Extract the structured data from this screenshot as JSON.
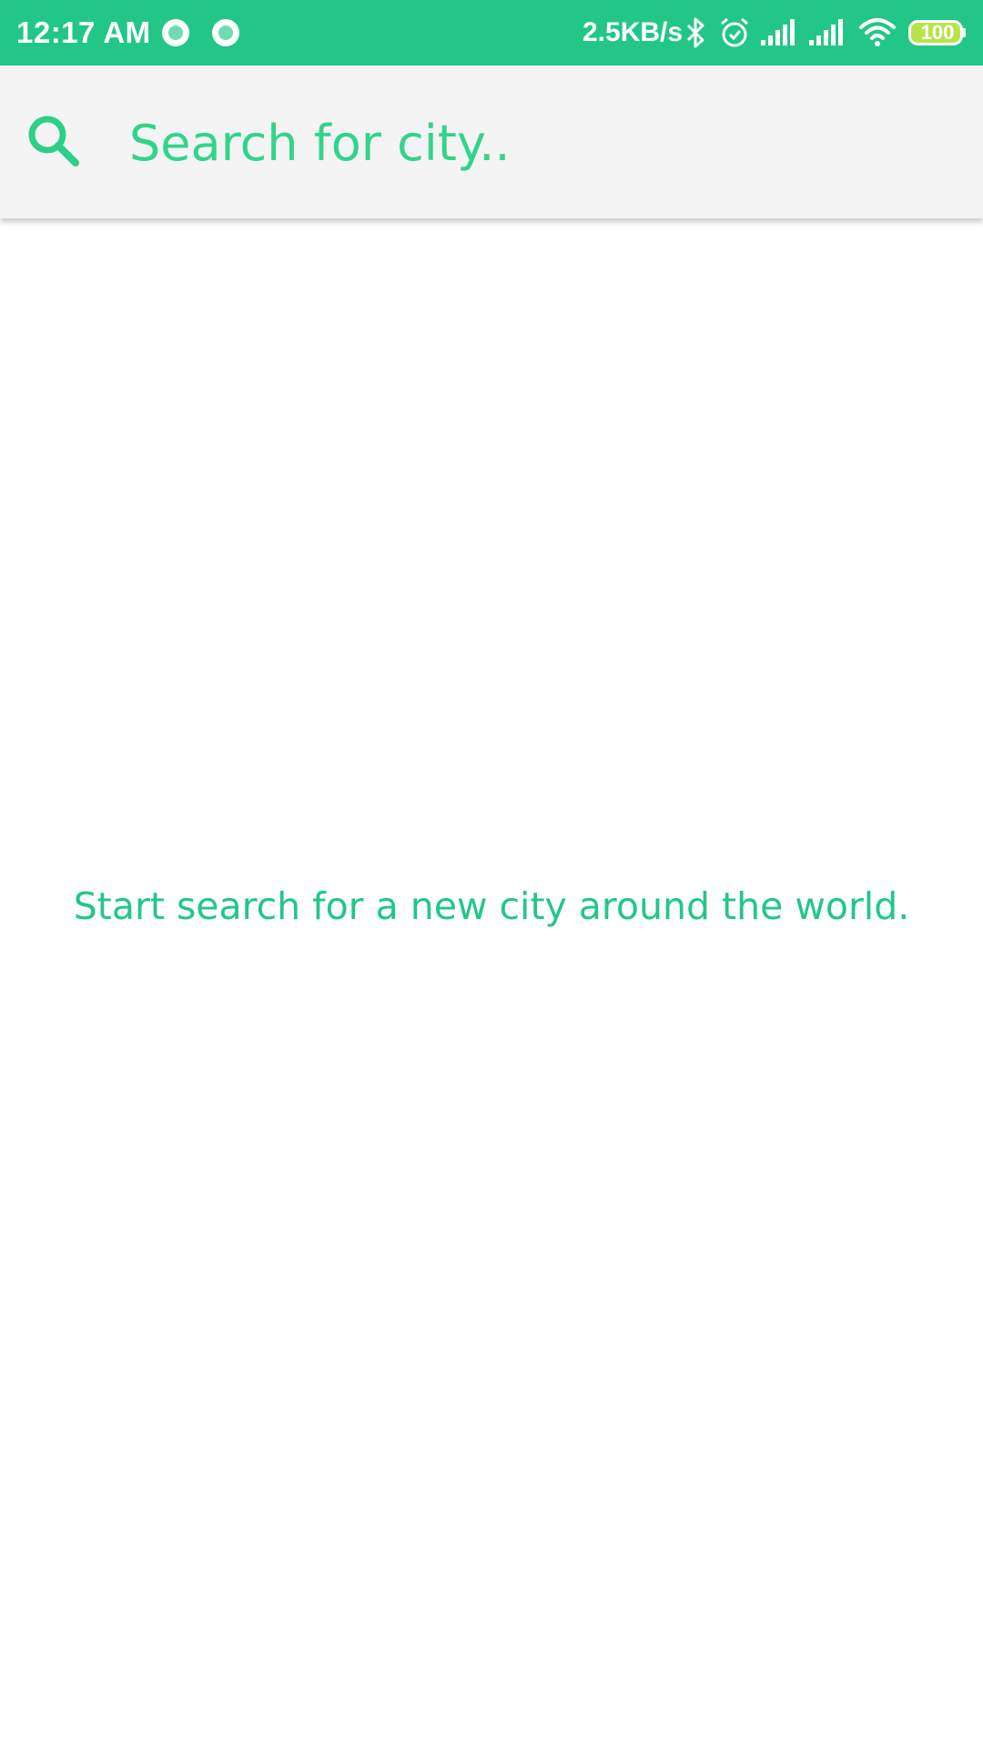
{
  "status_bar": {
    "time": "12:17 AM",
    "network_speed": "2.5KB/s",
    "battery_level": "100",
    "icons": [
      "notification-dot-icon",
      "notification-dot-icon",
      "bluetooth-icon",
      "alarm-icon",
      "signal-icon",
      "signal-icon",
      "wifi-icon",
      "battery-icon"
    ],
    "background_color": "#22c786"
  },
  "search": {
    "placeholder": "Search for city..",
    "value": "",
    "icon": "search-icon",
    "accent_color": "#2ecf87"
  },
  "main": {
    "empty_message": "Start search for a new city around the world."
  }
}
